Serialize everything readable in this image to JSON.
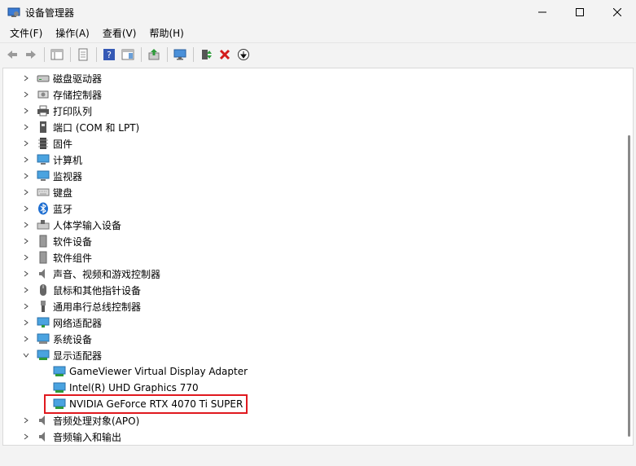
{
  "window": {
    "title": "设备管理器"
  },
  "menu": [
    "文件(F)",
    "操作(A)",
    "查看(V)",
    "帮助(H)"
  ],
  "tree": {
    "categories": [
      "磁盘驱动器",
      "存储控制器",
      "打印队列",
      "端口 (COM 和 LPT)",
      "固件",
      "计算机",
      "监视器",
      "键盘",
      "蓝牙",
      "人体学输入设备",
      "软件设备",
      "软件组件",
      "声音、视频和游戏控制器",
      "鼠标和其他指针设备",
      "通用串行总线控制器",
      "网络适配器",
      "系统设备",
      "显示适配器"
    ],
    "display_children": [
      "GameViewer Virtual Display Adapter",
      "Intel(R) UHD Graphics 770",
      "NVIDIA GeForce RTX 4070 Ti SUPER"
    ],
    "after": [
      "音频处理对象(APO)",
      "音频输入和输出"
    ]
  },
  "colors": {
    "highlight_border": "#e0191f"
  }
}
